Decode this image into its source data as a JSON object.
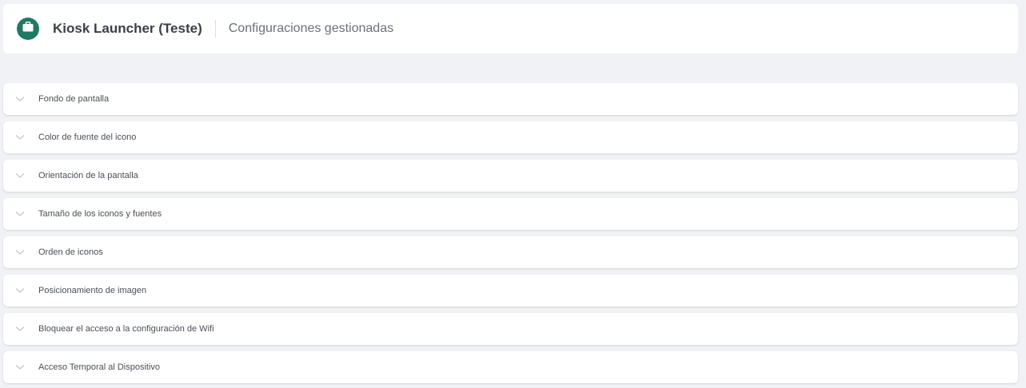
{
  "header": {
    "app_icon": "briefcase-icon",
    "app_icon_color": "#1f7a63",
    "title": "Kiosk Launcher (Teste)",
    "subtitle": "Configuraciones gestionadas"
  },
  "sections": [
    {
      "label": "Fondo de pantalla",
      "icon": "chevron-down-icon"
    },
    {
      "label": "Color de fuente del icono",
      "icon": "chevron-down-icon"
    },
    {
      "label": "Orientación de la pantalla",
      "icon": "chevron-down-icon"
    },
    {
      "label": "Tamaño de los iconos y fuentes",
      "icon": "chevron-down-icon"
    },
    {
      "label": "Orden de iconos",
      "icon": "chevron-down-icon"
    },
    {
      "label": "Posicionamiento de imagen",
      "icon": "chevron-down-icon"
    },
    {
      "label": "Bloquear el acceso a la configuración de Wifi",
      "icon": "chevron-down-icon"
    },
    {
      "label": "Acceso Temporal al Dispositivo",
      "icon": "chevron-down-icon"
    }
  ]
}
